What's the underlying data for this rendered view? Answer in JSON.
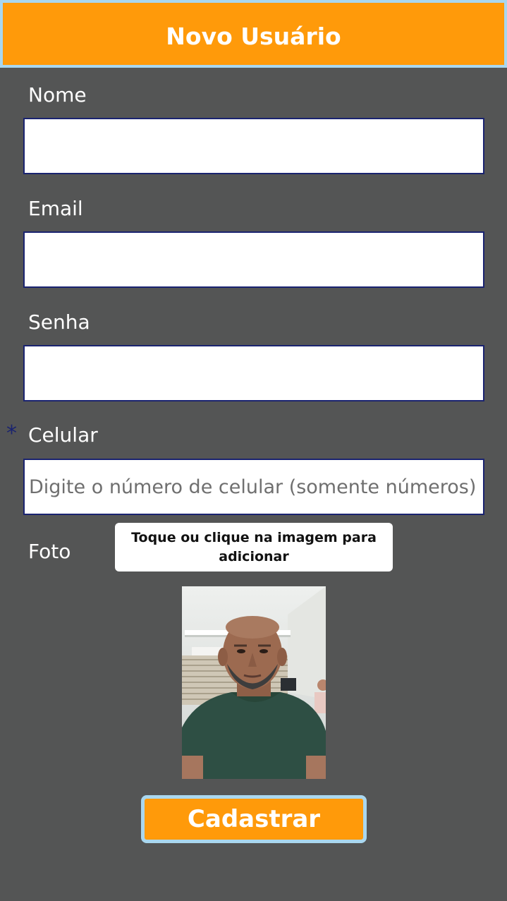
{
  "header": {
    "title": "Novo Usuário"
  },
  "form": {
    "nome": {
      "label": "Nome",
      "value": "",
      "placeholder": ""
    },
    "email": {
      "label": "Email",
      "value": "",
      "placeholder": ""
    },
    "senha": {
      "label": "Senha",
      "value": "",
      "placeholder": ""
    },
    "celular": {
      "required_marker": "*",
      "label": "Celular",
      "value": "",
      "placeholder": "Digite o número de celular (somente números)"
    },
    "foto": {
      "label": "Foto",
      "upload_label": "Toque ou clique na imagem para adicionar"
    }
  },
  "actions": {
    "submit_label": "Cadastrar"
  },
  "colors": {
    "accent": "#ff9a0a",
    "accent_border": "#a9d7ef",
    "background": "#545555",
    "field_border": "#1a2370"
  }
}
